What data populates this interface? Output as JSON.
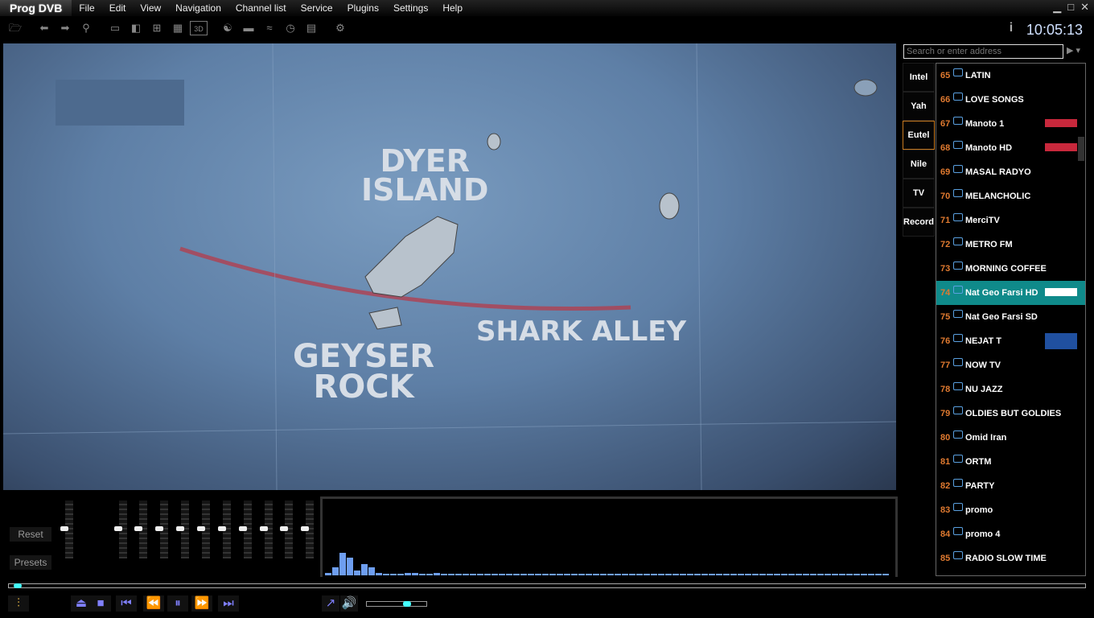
{
  "app": {
    "title": "Prog DVB",
    "clock": "10:05:13"
  },
  "menu": [
    "File",
    "Edit",
    "View",
    "Navigation",
    "Channel list",
    "Service",
    "Plugins",
    "Settings",
    "Help"
  ],
  "toolbar": {
    "icons": [
      "open-folder",
      "back-arrow",
      "forward-arrow",
      "search",
      "single-view",
      "split-view",
      "quad-view",
      "grid-view",
      "3d-view",
      "yin-yang",
      "bar",
      "teletext",
      "clock",
      "document",
      "gear"
    ],
    "view3d_label": "3D"
  },
  "video": {
    "labels": [
      "DYER\nISLAND",
      "GEYSER\nROCK",
      "SHARK ALLEY"
    ]
  },
  "search": {
    "placeholder": "Search or enter address"
  },
  "sat_tabs": [
    {
      "label": "Intel"
    },
    {
      "label": "Yah"
    },
    {
      "label": "Eutel",
      "active": true
    },
    {
      "label": "Nile"
    },
    {
      "label": "TV"
    },
    {
      "label": "Record"
    }
  ],
  "channels": [
    {
      "n": "65",
      "name": "LATIN"
    },
    {
      "n": "66",
      "name": "LOVE SONGS"
    },
    {
      "n": "67",
      "name": "Manoto 1",
      "logo": "manoto"
    },
    {
      "n": "68",
      "name": "Manoto HD",
      "logo": "manoto"
    },
    {
      "n": "69",
      "name": "MASAL RADYO"
    },
    {
      "n": "70",
      "name": "MELANCHOLIC"
    },
    {
      "n": "71",
      "name": "MerciTV"
    },
    {
      "n": "72",
      "name": "METRO FM"
    },
    {
      "n": "73",
      "name": "MORNING COFFEE"
    },
    {
      "n": "74",
      "name": "Nat Geo Farsi HD",
      "selected": true,
      "logo": "NATIONAL GEOGRAPHIC"
    },
    {
      "n": "75",
      "name": "Nat Geo Farsi SD"
    },
    {
      "n": "76",
      "name": "NEJAT T",
      "logo": "نجات"
    },
    {
      "n": "77",
      "name": "NOW TV"
    },
    {
      "n": "78",
      "name": "NU JAZZ"
    },
    {
      "n": "79",
      "name": "OLDIES BUT GOLDIES"
    },
    {
      "n": "80",
      "name": "Omid Iran"
    },
    {
      "n": "81",
      "name": "ORTM"
    },
    {
      "n": "82",
      "name": "PARTY"
    },
    {
      "n": "83",
      "name": "promo"
    },
    {
      "n": "84",
      "name": "promo 4"
    },
    {
      "n": "85",
      "name": "RADIO SLOW TIME"
    }
  ],
  "equalizer": {
    "reset": "Reset",
    "presets": "Presets",
    "levels": [
      0,
      0,
      0,
      0,
      0,
      0,
      0,
      0,
      0,
      0,
      0
    ]
  },
  "spectrum": [
    3,
    10,
    28,
    22,
    6,
    14,
    10,
    3,
    2,
    2,
    2,
    3,
    3,
    2,
    2,
    3,
    2,
    2,
    2,
    2,
    2,
    2,
    2,
    2,
    2,
    2,
    2,
    2,
    2,
    2,
    2,
    2,
    2,
    2,
    2,
    2,
    2,
    2,
    2,
    2,
    2,
    2,
    2,
    2,
    2,
    2,
    2,
    2,
    2,
    2,
    2,
    2,
    2,
    2,
    2,
    2,
    2,
    2,
    2,
    2,
    2,
    2,
    2,
    2,
    2,
    2,
    2,
    2,
    2,
    2,
    2,
    2,
    2,
    2,
    2,
    2,
    2,
    2
  ],
  "playback": {
    "position": 0.005,
    "volume": 0.65,
    "buttons": [
      "eject",
      "stop",
      "skip-back",
      "rewind",
      "pause",
      "fast-forward",
      "skip-forward"
    ]
  },
  "colors": {
    "accent": "#8080ff",
    "selected_row": "#0f8a8a",
    "channel_number": "#e07a30"
  }
}
